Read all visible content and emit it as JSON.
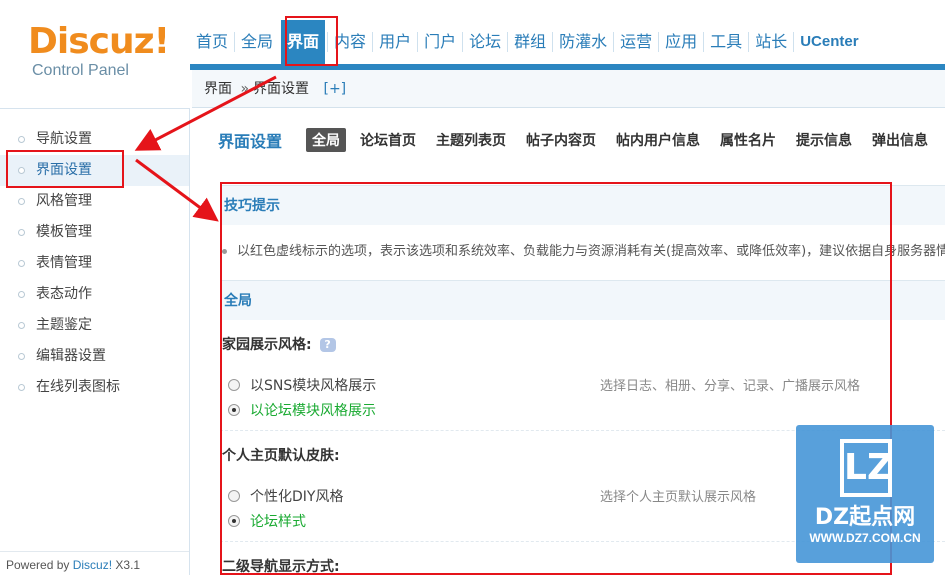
{
  "logo": {
    "brand": "Discuz!",
    "subtitle": "Control Panel"
  },
  "topnav": [
    "首页",
    "全局",
    "界面",
    "内容",
    "用户",
    "门户",
    "论坛",
    "群组",
    "防灌水",
    "运营",
    "应用",
    "工具",
    "站长",
    "UCenter"
  ],
  "breadcrumb": {
    "parent": "界面",
    "separator": "»",
    "current": "界面设置",
    "add": "[+]"
  },
  "sidebar": {
    "items": [
      "导航设置",
      "界面设置",
      "风格管理",
      "模板管理",
      "表情管理",
      "表态动作",
      "主题鉴定",
      "编辑器设置",
      "在线列表图标"
    ],
    "footer": {
      "prefix": "Powered by",
      "link": "Discuz!",
      "version": "X3.1"
    }
  },
  "main": {
    "title": "界面设置",
    "tabs": [
      "全局",
      "论坛首页",
      "主题列表页",
      "帖子内容页",
      "帖内用户信息",
      "属性名片",
      "提示信息",
      "弹出信息"
    ],
    "tip_header": "技巧提示",
    "tip_text": "以红色虚线标示的选项，表示该选项和系统效率、负载能力与资源消耗有关(提高效率、或降低效率)，建议依据自身服务器情况进行调整。",
    "section_header": "全局",
    "settings": [
      {
        "title": "家园展示风格:",
        "help": "?",
        "options": [
          "以SNS模块风格展示",
          "以论坛模块风格展示"
        ],
        "selected": 1,
        "description": "选择日志、相册、分享、记录、广播展示风格"
      },
      {
        "title": "个人主页默认皮肤:",
        "options": [
          "个性化DIY风格",
          "论坛样式"
        ],
        "selected": 1,
        "description": "选择个人主页默认展示风格"
      },
      {
        "title": "二级导航显示方式:"
      }
    ]
  },
  "watermark": {
    "logo": "LZ",
    "name": "DZ起点网",
    "url": "WWW.DZ7.COM.CN"
  },
  "colors": {
    "accent": "#2b86c1",
    "annotation": "#e5141a",
    "selected_option": "#1aaa32",
    "logo_orange": "#f08c1e"
  }
}
